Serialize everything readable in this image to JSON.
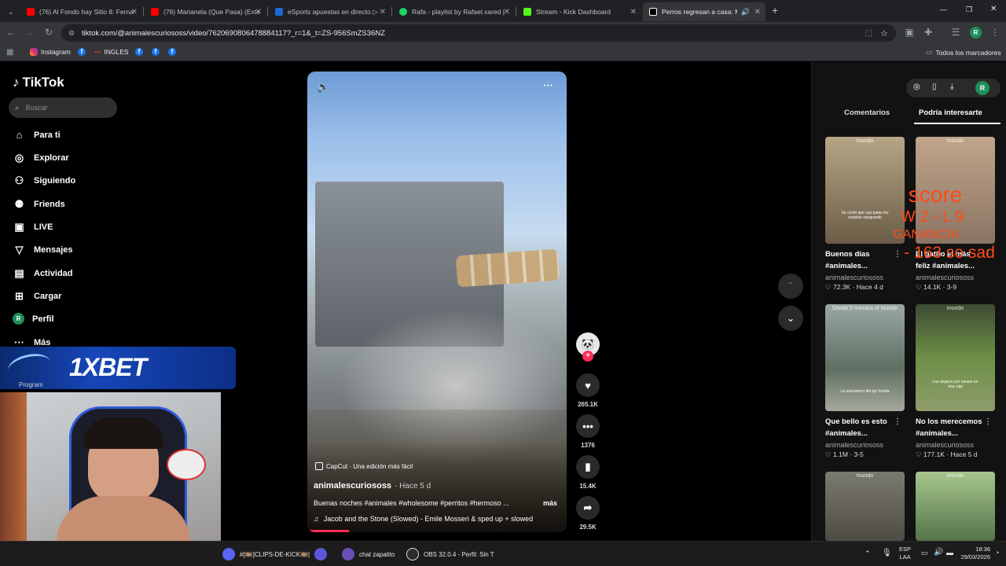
{
  "browser": {
    "tabs": [
      {
        "title": "(76) Al Fondo hay Sitio 8: Ferna",
        "fav_color": "#ff0000"
      },
      {
        "title": "(76) Marianela (Que Pasa) (Exte",
        "fav_color": "#ff0000"
      },
      {
        "title": "eSports apuestas en directo ▷",
        "fav_color": "#1c6bd6"
      },
      {
        "title": "Rafa - playlist by Rafael.xared |",
        "fav_color": "#1ed760"
      },
      {
        "title": "Stream - Kick Dashboard",
        "fav_color": "#53fc18"
      },
      {
        "title": "Perros regresan a casa: Mo",
        "fav_color": "#ffffff"
      }
    ],
    "new_tab": "+",
    "window_controls": {
      "minimize": "—",
      "restore": "❐",
      "close": "✕"
    },
    "url": "tiktok.com/@animalescuriososs/video/7620690806478884117?_r=1&_t=ZS-956SmZS36NZ",
    "bookmarks": [
      {
        "label": "Instagram",
        "icon": "instagram-icon"
      },
      {
        "label": "f",
        "icon": "facebook-icon"
      },
      {
        "label": "INGLES",
        "icon": "flag-icon"
      },
      {
        "label": "f",
        "icon": "facebook-icon"
      },
      {
        "label": "f",
        "icon": "facebook-icon"
      },
      {
        "label": "f",
        "icon": "facebook-icon"
      }
    ],
    "all_bookmarks": "Todos los marcadores",
    "profile_initial": "R"
  },
  "tiktok": {
    "logo": "TikTok",
    "search_placeholder": "Buscar",
    "nav": [
      {
        "label": "Para ti",
        "icon": "home-icon"
      },
      {
        "label": "Explorar",
        "icon": "compass-icon"
      },
      {
        "label": "Siguiendo",
        "icon": "following-icon"
      },
      {
        "label": "Friends",
        "icon": "friends-icon"
      },
      {
        "label": "LIVE",
        "icon": "live-icon"
      },
      {
        "label": "Mensajes",
        "icon": "messages-icon"
      },
      {
        "label": "Actividad",
        "icon": "activity-icon"
      },
      {
        "label": "Cargar",
        "icon": "upload-icon"
      },
      {
        "label": "Perfil",
        "icon": "profile-icon"
      },
      {
        "label": "Más",
        "icon": "more-icon"
      }
    ],
    "profile_initial": "R",
    "video": {
      "capcut": "CapCut · Una edición más fácil",
      "author": "animalescuriososs",
      "posted": "· Hace 5 d",
      "caption": "Buenas noches #animales #wholesome #perritos #hermoso ...",
      "more": "más",
      "music": "Jacob and the Stone (Slowed) - Emile Mosseri & sped up + slowed",
      "progress": 0.16
    },
    "actions": {
      "likes": "265.1K",
      "comments": "1376",
      "saves": "15.4K",
      "shares": "29.5K"
    },
    "right_panel": {
      "tab_comments": "Comentarios",
      "tab_suggest": "Podría interesarte",
      "cards": [
        {
          "title": "Buenos días",
          "tag": "#animales...",
          "author": "animalescuriososs",
          "likes": "72.3K",
          "date": "Hace 4 d",
          "watermark": "mundo",
          "bg": "#8a7f6a",
          "caption": "Se contó que sus patas les estaban sangrando"
        },
        {
          "title": "El gatito el más",
          "tag": "feliz #animales...",
          "author": "animalescuriososs",
          "likes": "14.1K",
          "date": "3-9",
          "watermark": "mundo",
          "bg": "#a08c7a",
          "caption": ""
        },
        {
          "title": "Que bello es esto",
          "tag": "#animales...",
          "author": "animalescuriososs",
          "likes": "1.1M",
          "date": "3-5",
          "watermark": "Olvida 5 minutos el mundo",
          "bg": "#5f6f63",
          "caption": "La rescataron del ojo herida"
        },
        {
          "title": "No los merecemos",
          "tag": "#animales...",
          "author": "animalescuriososs",
          "likes": "177.1K",
          "date": "Hace 5 d",
          "watermark": "mundo",
          "bg": "#5d7a46",
          "caption": "Los dejaron por meses en una caja"
        },
        {
          "title": "",
          "tag": "",
          "author": "",
          "likes": "",
          "date": "",
          "watermark": "mundo",
          "bg": "#6d6a60",
          "caption": ""
        },
        {
          "title": "",
          "tag": "",
          "author": "",
          "likes": "",
          "date": "",
          "watermark": "mundo",
          "bg": "#6e8e5f",
          "caption": ""
        }
      ]
    }
  },
  "stream_overlay": {
    "score_title": "score",
    "score_line": "W 2 - L 9",
    "ganancia_label": "GANANCIA",
    "ganancia_value": "- 163 so sad",
    "sponsor": "1XBET",
    "sponsor_sub": "Program"
  },
  "taskbar": {
    "items": [
      {
        "label": "#[🎞️]CLIPS-DE-KICK🎞️|",
        "icon": "discord-icon",
        "color": "#5865f2"
      },
      {
        "label": "",
        "icon": "app-icon",
        "color": "#5b58d6"
      },
      {
        "label": "chat zapatito",
        "icon": "app2-icon",
        "color": "#6a4fb5"
      },
      {
        "label": "OBS 32.0.4 - Perfil: Sin T",
        "icon": "obs-icon",
        "color": "#2b2b2b"
      }
    ],
    "lang": "ESP",
    "lang2": "LAA",
    "time": "18:36",
    "date": "29/03/2026"
  }
}
